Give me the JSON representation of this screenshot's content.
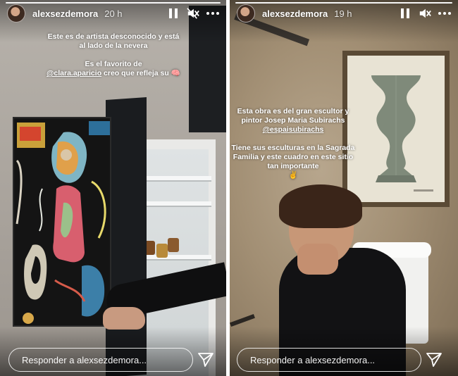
{
  "stories": [
    {
      "username": "alexsezdemora",
      "timestamp": "20 h",
      "caption": {
        "paragraph1": "Este es de artista desconocido y está al lado de la nevera",
        "p2_line1": "Es el favorito de",
        "p2_mention": "@clara.aparicio",
        "p2_after_mention": "creo que refleja su",
        "p2_emoji": "🧠"
      },
      "reply_placeholder": "Responder a alexsezdemora...",
      "icons": {
        "pause": "pause-icon",
        "mute": "mute-icon",
        "more": "more-icon",
        "send": "send-icon"
      }
    },
    {
      "username": "alexsezdemora",
      "timestamp": "19 h",
      "caption": {
        "p1_text": "Esta obra es del gran escultor y pintor Josep Maria Subirachs",
        "p1_mention": "@espaisubirachs",
        "paragraph2": "Tiene sus esculturas en la Sagrada Familia y este cuadro en este sitio tan importante",
        "p2_emoji": "✌"
      },
      "reply_placeholder": "Responder a alexsezdemora...",
      "icons": {
        "pause": "pause-icon",
        "mute": "mute-icon",
        "more": "more-icon",
        "send": "send-icon"
      }
    }
  ]
}
